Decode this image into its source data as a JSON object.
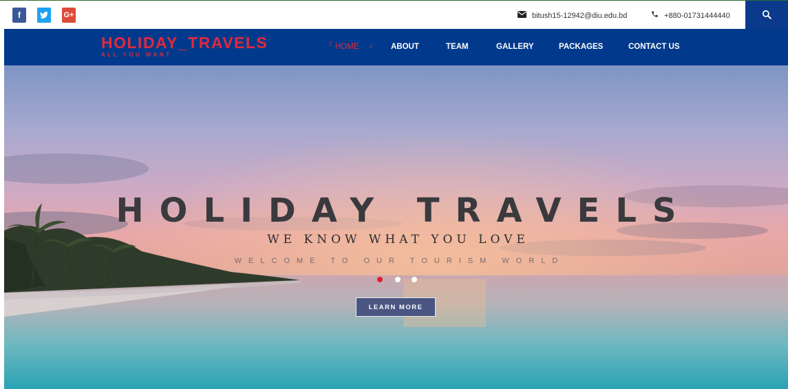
{
  "social": [
    {
      "name": "facebook",
      "glyph": "f",
      "icon": "facebook-icon"
    },
    {
      "name": "twitter",
      "glyph": "",
      "icon": "twitter-icon"
    },
    {
      "name": "google-plus",
      "glyph": "G+",
      "icon": "google-plus-icon"
    }
  ],
  "contact": {
    "email": "bitush15-12942@diu.edu.bd",
    "phone": "+880-01731444440",
    "email_icon": "envelope-icon",
    "phone_icon": "phone-icon"
  },
  "search_icon": "search-icon",
  "brand": {
    "title": "HOLIDAY_TRAVELS",
    "tagline": "ALL YOU WANT"
  },
  "nav": {
    "items": [
      {
        "label": "HOME",
        "active": true
      },
      {
        "label": "ABOUT",
        "active": false
      },
      {
        "label": "TEAM",
        "active": false
      },
      {
        "label": "GALLERY",
        "active": false
      },
      {
        "label": "PACKAGES",
        "active": false
      },
      {
        "label": "CONTACT US",
        "active": false
      }
    ]
  },
  "hero": {
    "title": "HOLIDAY TRAVELS",
    "subtitle": "WE KNOW WHAT YOU LOVE",
    "welcome": "WELCOME TO OUR TOURISM WORLD",
    "button_label": "LEARN MORE",
    "slides": 3,
    "active_slide": 1
  },
  "colors": {
    "nav_bg": "#013a8c",
    "brand_red": "#e02a3c",
    "button_bg": "#4a5582"
  }
}
